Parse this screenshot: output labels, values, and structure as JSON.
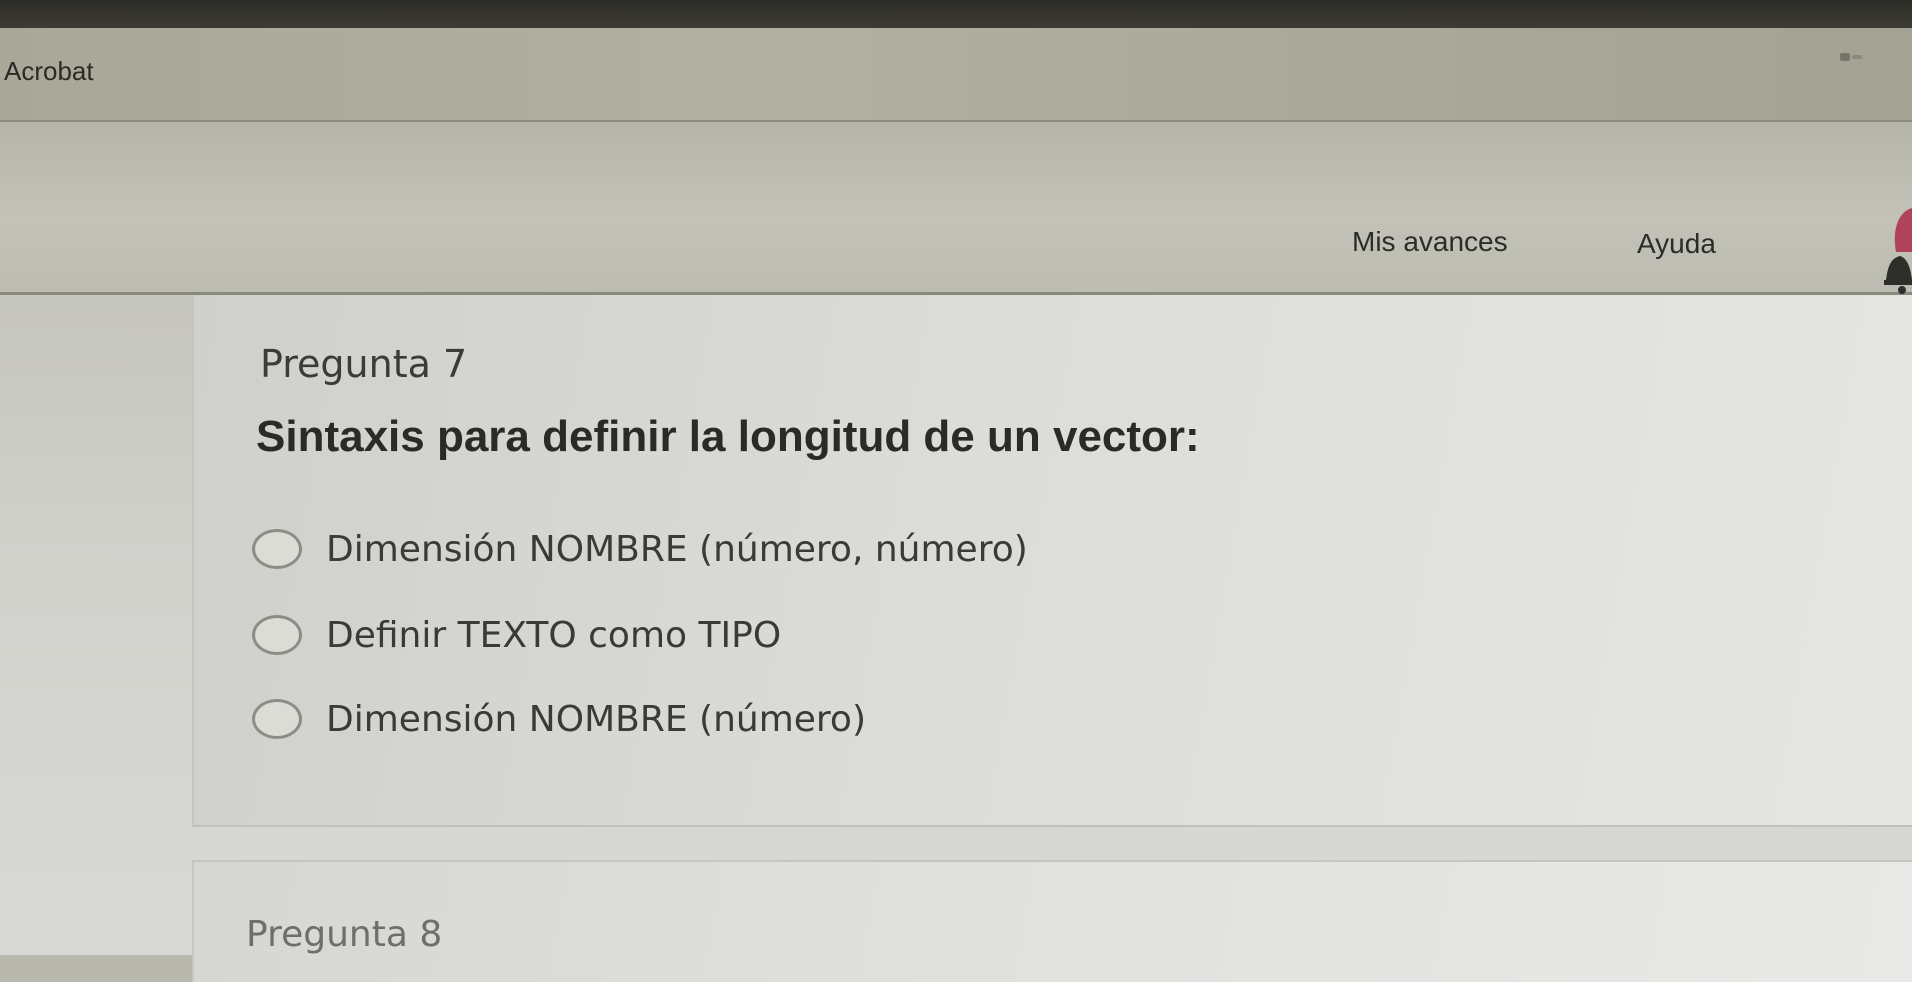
{
  "browser": {
    "bookmark_label": "Acrobat"
  },
  "header": {
    "nav": {
      "progress_label": "Mis avances",
      "help_label": "Ayuda"
    }
  },
  "quiz": {
    "question": {
      "number_label": "Pregunta 7",
      "text": "Sintaxis para definir la longitud de un vector:",
      "options": [
        {
          "label": "Dimensión NOMBRE (número, número)",
          "selected": false
        },
        {
          "label": "Definir TEXTO como TIPO",
          "selected": false
        },
        {
          "label": "Dimensión NOMBRE (número)",
          "selected": false
        }
      ]
    },
    "next_question": {
      "number_label": "Pregunta 8"
    }
  },
  "colors": {
    "header_bg": "#c3c2b8",
    "content_bg": "#d9d9d6",
    "notification_accent": "#b0435a"
  },
  "icons": {
    "notification": "bell-icon",
    "radio": "radio-button-icon"
  }
}
